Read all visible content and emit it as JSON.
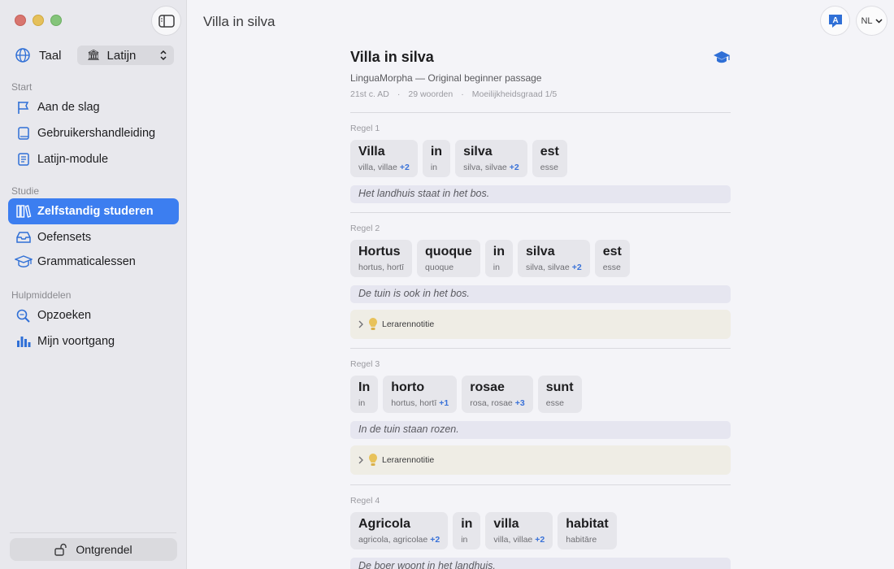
{
  "app": {
    "window_title": "Villa in silva"
  },
  "sidebar": {
    "language_label": "Taal",
    "language_value": "Latijn",
    "sections": {
      "start": "Start",
      "study": "Studie",
      "tools": "Hulpmiddelen"
    },
    "items": [
      {
        "label": "Aan de slag",
        "icon": "flag-icon"
      },
      {
        "label": "Gebruikershandleiding",
        "icon": "book-icon"
      },
      {
        "label": "Latijn-module",
        "icon": "document-icon"
      },
      {
        "label": "Zelfstandig studeren",
        "icon": "books-icon",
        "active": true
      },
      {
        "label": "Oefensets",
        "icon": "tray-icon"
      },
      {
        "label": "Grammaticalessen",
        "icon": "graduation-cap-icon"
      },
      {
        "label": "Opzoeken",
        "icon": "search-icon"
      },
      {
        "label": "Mijn voortgang",
        "icon": "chart-icon"
      }
    ],
    "unlock_label": "Ontgrendel"
  },
  "toolbar": {
    "locale": "NL"
  },
  "doc": {
    "title": "Villa in silva",
    "source": "LinguaMorpha — Original beginner passage",
    "era": "21st c. AD",
    "word_count": "29 woorden",
    "difficulty": "Moeilijkheidsgraad 1/5"
  },
  "lines": [
    {
      "label": "Regel 1",
      "tokens": [
        {
          "word": "Villa",
          "forms": "villa, villae",
          "more": "+2"
        },
        {
          "word": "in",
          "forms": "in",
          "more": ""
        },
        {
          "word": "silva",
          "forms": "silva, silvae",
          "more": "+2"
        },
        {
          "word": "est",
          "forms": "esse",
          "more": ""
        }
      ],
      "translation": "Het landhuis staat in het bos.",
      "note": ""
    },
    {
      "label": "Regel 2",
      "tokens": [
        {
          "word": "Hortus",
          "forms": "hortus, hortī",
          "more": ""
        },
        {
          "word": "quoque",
          "forms": "quoque",
          "more": ""
        },
        {
          "word": "in",
          "forms": "in",
          "more": ""
        },
        {
          "word": "silva",
          "forms": "silva, silvae",
          "more": "+2"
        },
        {
          "word": "est",
          "forms": "esse",
          "more": ""
        }
      ],
      "translation": "De tuin is ook in het bos.",
      "note": "Lerarennotitie"
    },
    {
      "label": "Regel 3",
      "tokens": [
        {
          "word": "In",
          "forms": "in",
          "more": ""
        },
        {
          "word": "horto",
          "forms": "hortus, hortī",
          "more": "+1"
        },
        {
          "word": "rosae",
          "forms": "rosa, rosae",
          "more": "+3"
        },
        {
          "word": "sunt",
          "forms": "esse",
          "more": ""
        }
      ],
      "translation": "In de tuin staan rozen.",
      "note": "Lerarennotitie"
    },
    {
      "label": "Regel 4",
      "tokens": [
        {
          "word": "Agricola",
          "forms": "agricola, agricolae",
          "more": "+2"
        },
        {
          "word": "in",
          "forms": "in",
          "more": ""
        },
        {
          "word": "villa",
          "forms": "villa, villae",
          "more": "+2"
        },
        {
          "word": "habitat",
          "forms": "habitāre",
          "more": ""
        }
      ],
      "translation": "De boer woont in het landhuis.",
      "note": ""
    }
  ],
  "colors": {
    "accent": "#3c7ef0",
    "sidebar_bg": "#e8e8ed",
    "note_bg": "#efede5"
  }
}
